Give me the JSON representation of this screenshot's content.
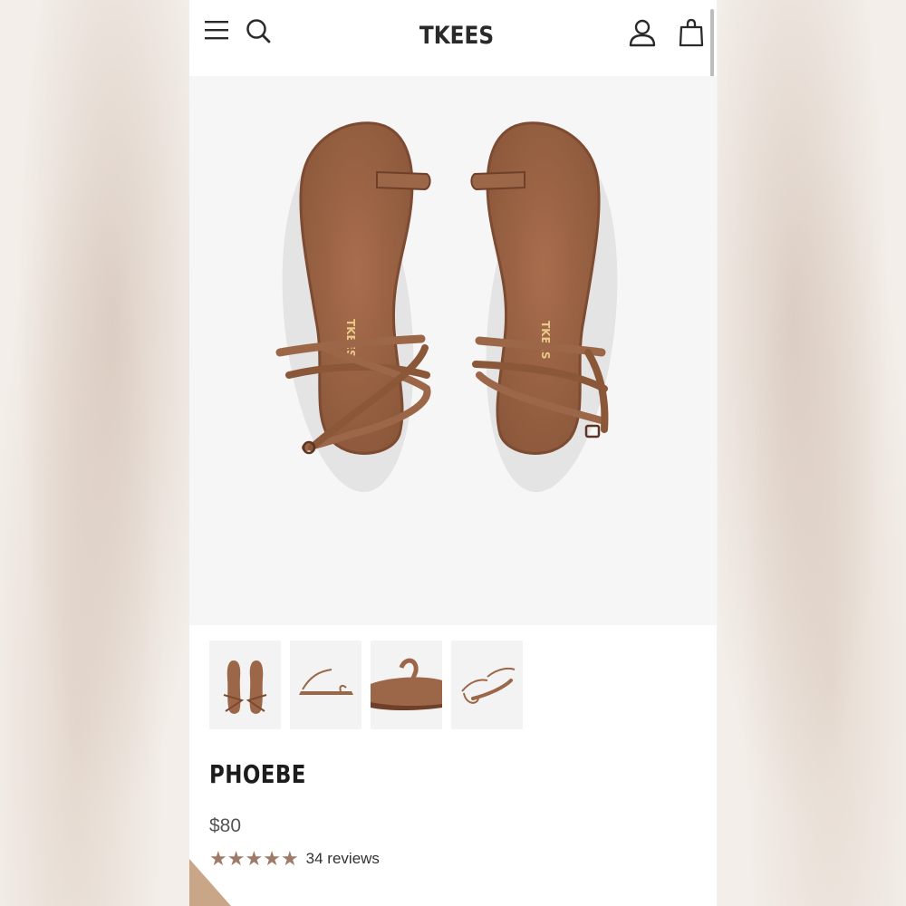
{
  "header": {
    "brand": "TKEES",
    "icons": [
      "menu-icon",
      "search-icon",
      "account-icon",
      "cart-icon"
    ]
  },
  "product": {
    "name": "PHOEBE",
    "price": "$80",
    "rating": {
      "stars": 5,
      "max": 5
    },
    "reviews_label": "34 reviews"
  },
  "gallery": {
    "thumbnails": [
      "top-view",
      "side-view",
      "sole-close-up",
      "angled-view"
    ]
  },
  "colors": {
    "brand_text": "#2a2a2a",
    "leather": "#9c6648",
    "leather_dark": "#7d4b31",
    "star": "#a07a68",
    "accent_corner": "#c8a687"
  }
}
